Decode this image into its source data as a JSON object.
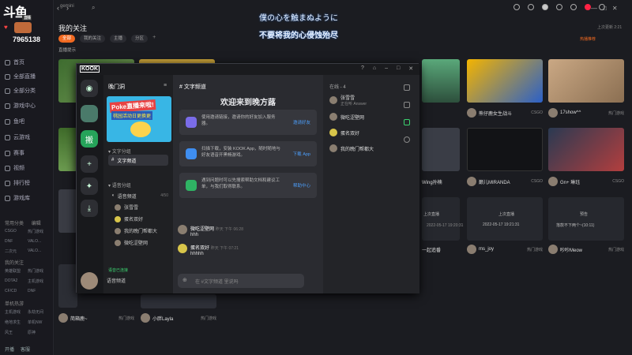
{
  "app": {
    "logo_text": "斗鱼",
    "logo_sub": "直播"
  },
  "sidebar": {
    "user_id": "7965138",
    "items": [
      {
        "label": "首页",
        "icon": "home-icon"
      },
      {
        "label": "全部直播",
        "icon": "live-icon"
      },
      {
        "label": "全部分类",
        "icon": "category-icon"
      },
      {
        "label": "游戏中心",
        "icon": "game-icon"
      },
      {
        "label": "鱼吧",
        "icon": "bar-icon"
      },
      {
        "label": "云游戏",
        "icon": "cloud-game-icon"
      },
      {
        "label": "赛事",
        "icon": "trophy-icon"
      },
      {
        "label": "视频",
        "icon": "video-icon"
      },
      {
        "label": "排行榜",
        "icon": "rank-icon"
      },
      {
        "label": "游戏库",
        "icon": "library-icon"
      }
    ],
    "section1": {
      "title": "常用分类",
      "more": "编辑",
      "tags": [
        "CSGO",
        "热门游戏",
        "DNF",
        "VALO...",
        "二次元",
        "VALO..."
      ]
    },
    "section2": {
      "title": "我的关注",
      "tags": [
        "英雄联盟",
        "热门游戏",
        "DOTA2",
        "主机游戏",
        "CF/CD",
        "DNF"
      ]
    },
    "section3": {
      "title": "单机热游",
      "tags": [
        "主机游戏",
        "永劫无间",
        "绝地求生",
        "单机NW",
        "风王",
        "原神"
      ]
    },
    "bottom": [
      "开播",
      "客服"
    ]
  },
  "topbar": {
    "search_placeholder": "gemini",
    "lyric_line1": "僕の心を触まぬように",
    "lyric_line2": "不要将我的心侵蚀殆尽",
    "window_controls": [
      "—",
      "□",
      "✕"
    ]
  },
  "page": {
    "title": "我的关注",
    "tabs": [
      "全部",
      "我的关注",
      "主播",
      "分区"
    ],
    "active_tab": "全部",
    "filter": "直播提示",
    "right_action": "热播推荐",
    "right_time": "上次更新 2:21"
  },
  "cards": [
    {
      "name": "熊仔鹿女生战斗",
      "tag": "CSGO",
      "count": "1.7万"
    },
    {
      "name": "17show^^",
      "tag": "热门游戏",
      "count": "7.8万"
    },
    {
      "name": "Wing孙楠",
      "tag": "CSGO",
      "count": "1.8万"
    },
    {
      "name": "巅儿MIRANDA",
      "tag": "CSGO",
      "count": "2万"
    },
    {
      "name": "Gn+ 琳珏",
      "tag": "CSGO",
      "count": "2.7万"
    },
    {
      "name": "一起追番",
      "tag": "热门游戏",
      "count": "1.2万"
    },
    {
      "name": "ms_joy",
      "tag": "热门游戏",
      "count": "6.8万"
    },
    {
      "name": "吵吵Meow",
      "tag": "热门游戏",
      "count": "3.4万"
    },
    {
      "name": "简箱鹿~",
      "tag": "热门游戏",
      "count": "2万"
    },
    {
      "name": "小胖Layla",
      "tag": "热门游戏",
      "count": "1.6万"
    }
  ],
  "card_badges": [
    "上次直播",
    "2022-05-17 19:20:31",
    "上次直播",
    "2022-05-17 19:21:31",
    "预告",
    "落款不下两个~(10:11)"
  ],
  "kook": {
    "logo": "KOOK",
    "server_name": "晚门洞",
    "banner_title": "Poke直播来啦!",
    "banner_sub": "桃园活动日更换更",
    "categories": [
      "文字分组",
      "语音分组"
    ],
    "text_channels": [
      "文字频道"
    ],
    "voice_channel": "语音频道",
    "voice_count": "4/50",
    "voice_users": [
      "张雪雪",
      "蛋名双好",
      "我的晚门帮都大",
      "微吃涩壁网"
    ],
    "green_text": "语音已连接",
    "user_name": "语音频道",
    "channel_header": "文字频道",
    "welcome": "欢迎来到晚方蕗",
    "tips": [
      {
        "text": "使用邀请链接，邀请你的好友加入服务器。",
        "link": "邀请好友"
      },
      {
        "text": "扫描下载，安装 KOOK App，随时随地与好友语音开黑畅游戏。",
        "link": "下载 App"
      },
      {
        "text": "遇到问题时可以先搜索帮助文档和建议工单，与我们取得联系。",
        "link": "帮助中心"
      }
    ],
    "messages": [
      {
        "name": "微吃涩壁网",
        "time": "昨天 下午 06:28",
        "body": "hhh"
      },
      {
        "name": "蛋名双好",
        "time": "昨天 下午 07:21",
        "body": "hhhhh"
      }
    ],
    "input_placeholder": "在 #文字频道 里说吗",
    "members_header": "在线 - 4",
    "members": [
      {
        "name": "张雪雪",
        "sub": "正在听 Answer"
      },
      {
        "name": "微吃涩壁网",
        "sub": ""
      },
      {
        "name": "蛋名双好",
        "sub": ""
      },
      {
        "name": "我的晚门帮都大",
        "sub": ""
      }
    ]
  }
}
